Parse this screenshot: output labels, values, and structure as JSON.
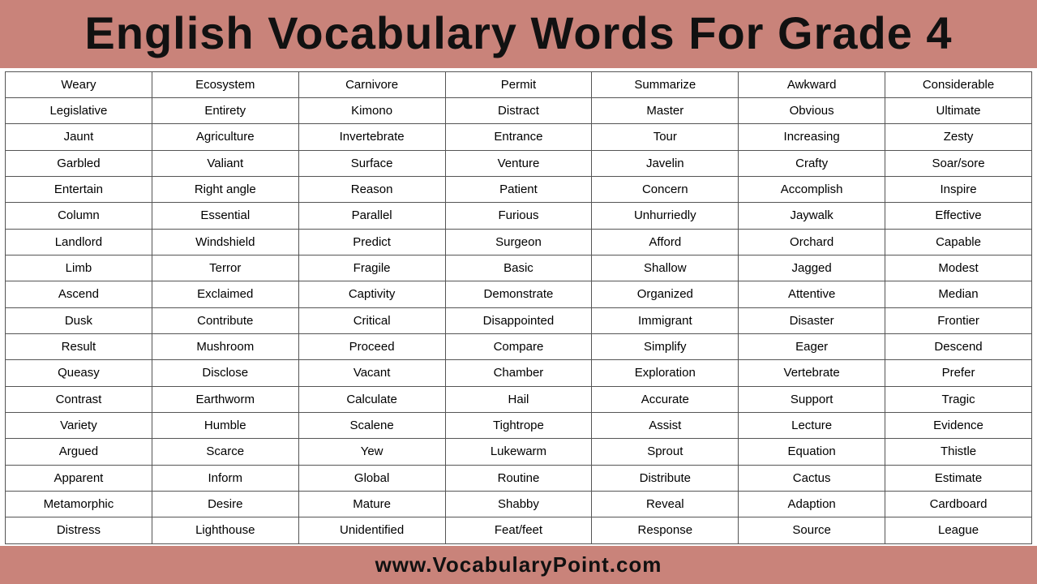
{
  "header": {
    "title": "English Vocabulary Words For Grade 4"
  },
  "footer": {
    "url": "www.VocabularyPoint.com"
  },
  "columns": [
    {
      "words": [
        "Weary",
        "Legislative",
        "Jaunt",
        "Garbled",
        "Entertain",
        "Column",
        "Landlord",
        "Limb",
        "Ascend",
        "Dusk",
        "Result",
        "Queasy",
        "Contrast",
        "Variety",
        "Argued",
        "Apparent",
        "Metamorphic",
        "Distress"
      ]
    },
    {
      "words": [
        "Ecosystem",
        "Entirety",
        "Agriculture",
        "Valiant",
        "Right angle",
        "Essential",
        "Windshield",
        "Terror",
        "Exclaimed",
        "Contribute",
        "Mushroom",
        "Disclose",
        "Earthworm",
        "Humble",
        "Scarce",
        "Inform",
        "Desire",
        "Lighthouse"
      ]
    },
    {
      "words": [
        "Carnivore",
        "Kimono",
        "Invertebrate",
        "Surface",
        "Reason",
        "Parallel",
        "Predict",
        "Fragile",
        "Captivity",
        "Critical",
        "Proceed",
        "Vacant",
        "Calculate",
        "Scalene",
        "Yew",
        "Global",
        "Mature",
        "Unidentified"
      ]
    },
    {
      "words": [
        "Permit",
        "Distract",
        "Entrance",
        "Venture",
        "Patient",
        "Furious",
        "Surgeon",
        "Basic",
        "Demonstrate",
        "Disappointed",
        "Compare",
        "Chamber",
        "Hail",
        "Tightrope",
        "Lukewarm",
        "Routine",
        "Shabby",
        "Feat/feet"
      ]
    },
    {
      "words": [
        "Summarize",
        "Master",
        "Tour",
        "Javelin",
        "Concern",
        "Unhurriedly",
        "Afford",
        "Shallow",
        "Organized",
        "Immigrant",
        "Simplify",
        "Exploration",
        "Accurate",
        "Assist",
        "Sprout",
        "Distribute",
        "Reveal",
        "Response"
      ]
    },
    {
      "words": [
        "Awkward",
        "Obvious",
        "Increasing",
        "Crafty",
        "Accomplish",
        "Jaywalk",
        "Orchard",
        "Jagged",
        "Attentive",
        "Disaster",
        "Eager",
        "Vertebrate",
        "Support",
        "Lecture",
        "Equation",
        "Cactus",
        "Adaption",
        "Source"
      ]
    },
    {
      "words": [
        "Considerable",
        "Ultimate",
        "Zesty",
        "Soar/sore",
        "Inspire",
        "Effective",
        "Capable",
        "Modest",
        "Median",
        "Frontier",
        "Descend",
        "Prefer",
        "Tragic",
        "Evidence",
        "Thistle",
        "Estimate",
        "Cardboard",
        "League"
      ]
    }
  ]
}
